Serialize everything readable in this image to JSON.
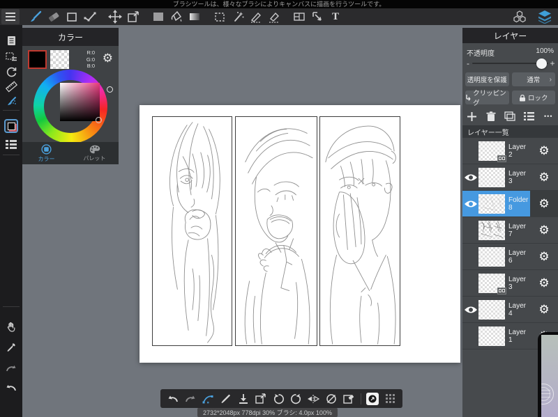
{
  "window": {
    "tooltip": "ブラシツールは、様々なブラシによりキャンバスに描画を行うツールです。",
    "status": "2732*2048px 778dpi 30% ブラシ: 4.0px 100%"
  },
  "top_toolbar": {
    "text_tool_label": "T"
  },
  "color_panel": {
    "title": "カラー",
    "r": "R:0",
    "g": "G:0",
    "b": "B:0",
    "tab_color": "カラー",
    "tab_palette": "パレット"
  },
  "layers_panel": {
    "title": "レイヤー",
    "opacity_label": "不透明度",
    "opacity_value": "100%",
    "minus": "-",
    "plus": "+",
    "protect_alpha": "透明度を保護",
    "blend_mode": "通常",
    "blend_chevron": "›",
    "clipping": "クリッピング",
    "lock": "ロック",
    "list_title": "レイヤー一覧",
    "more_label": "•••",
    "layers": [
      {
        "name": "Layer2",
        "visible": false,
        "selected": false,
        "badge": true,
        "thumb": "empty"
      },
      {
        "name": "Layer3",
        "visible": true,
        "selected": false,
        "badge": false,
        "thumb": "empty"
      },
      {
        "name": "Folder 8",
        "visible": true,
        "selected": true,
        "badge": false,
        "thumb": "sketch-light"
      },
      {
        "name": "Layer7",
        "visible": false,
        "selected": false,
        "badge": false,
        "thumb": "sketch-dense"
      },
      {
        "name": "Layer6",
        "visible": false,
        "selected": false,
        "badge": false,
        "thumb": "empty"
      },
      {
        "name": "Layer3",
        "visible": false,
        "selected": false,
        "badge": true,
        "thumb": "empty"
      },
      {
        "name": "Layer4",
        "visible": true,
        "selected": false,
        "badge": false,
        "thumb": "empty"
      },
      {
        "name": "Layer1",
        "visible": false,
        "selected": false,
        "badge": false,
        "thumb": "empty"
      }
    ]
  },
  "colors": {
    "accent_blue": "#449ce0",
    "selected_row": "#4699e0",
    "foreground_color": "#000000",
    "swatch_border_red": "#c0392f",
    "workspace_gray": "#70757c"
  }
}
